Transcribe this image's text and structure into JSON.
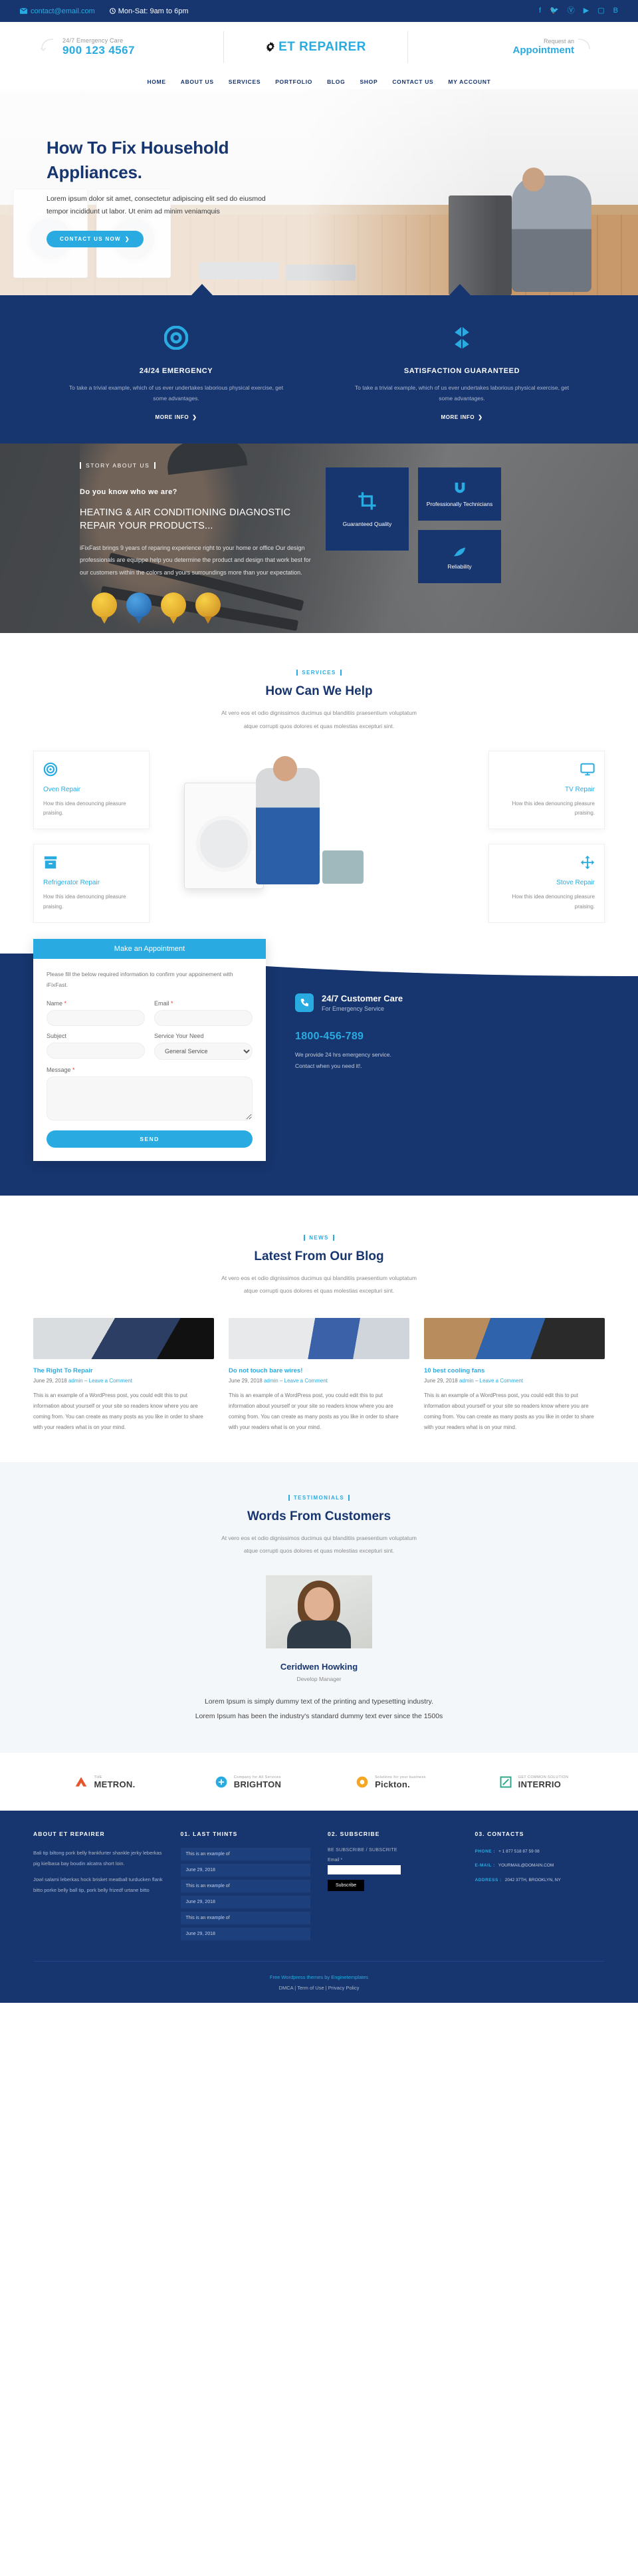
{
  "topbar": {
    "email": "contact@email.com",
    "hours": "Mon-Sat: 9am to 6pm",
    "social": [
      "facebook-icon",
      "twitter-icon",
      "pinterest-icon",
      "youtube-icon",
      "instagram-icon",
      "behance-icon"
    ]
  },
  "header": {
    "emergency_label": "24/7 Emergency Care",
    "phone": "900 123 4567",
    "logo": "ET REPAIRER",
    "appointment_label": "Request an",
    "appointment_value": "Appointment"
  },
  "nav": {
    "items": [
      "HOME",
      "ABOUT US",
      "SERVICES",
      "PORTFOLIO",
      "BLOG",
      "SHOP",
      "CONTACT US",
      "MY ACCOUNT"
    ]
  },
  "hero": {
    "title_line1": "How To Fix Household",
    "title_line2": "Appliances.",
    "paragraph": "Lorem ipsum dolor sit amet, consectetur adipiscing elit sed do eiusmod tempor incididunt ut labor. Ut enim ad minim veniamquis",
    "cta": "CONTACT US NOW"
  },
  "features": [
    {
      "icon": "lifebuoy-icon",
      "title": "24/24 EMERGENCY",
      "text": "To take a trivial example, which of us ever undertakes laborious physical exercise, get some advantages.",
      "more": "MORE INFO"
    },
    {
      "icon": "layers-icon",
      "title": "SATISFACTION GUARANTEED",
      "text": "To take a trivial example, which of us ever undertakes laborious physical exercise, get some advantages.",
      "more": "MORE INFO"
    }
  ],
  "story": {
    "kicker": "STORY ABOUT US",
    "subtitle": "Do you know who we are?",
    "heading": "HEATING & AIR CONDITIONING DIAGNOSTIC REPAIR YOUR PRODUCTS...",
    "paragraph": "iFixFast brings 9 years of reparing experience right to your home or office Our design professionals are equippe help you determine the product and design that work best for our customers within the colors and yours surroundings more than your expectation.",
    "boxes": [
      {
        "icon": "crop-icon",
        "label": "Guaranteed Quality"
      },
      {
        "icon": "magnet-icon",
        "label": "Professionally Technicians"
      },
      {
        "icon": "leaf-icon",
        "label": "Reliability"
      }
    ]
  },
  "services": {
    "kicker": "SERVICES",
    "title": "How Can We Help",
    "sub_line1": "At vero eos et odio dignissimos ducimus qui blanditiis praesentium voluptatum",
    "sub_line2": "atque corrupti quos dolores et quas molestias excepturi sint.",
    "left": [
      {
        "icon": "target-icon",
        "title": "Oven Repair",
        "text": "How this idea denouncing pleasure praising."
      },
      {
        "icon": "box-icon",
        "title": "Refrigerator Repair",
        "text": "How this idea denouncing pleasure praising."
      }
    ],
    "right": [
      {
        "icon": "monitor-icon",
        "title": "TV Repair",
        "text": "How this idea denouncing pleasure praising."
      },
      {
        "icon": "move-icon",
        "title": "Stove Repair",
        "text": "How this idea denouncing pleasure praising."
      }
    ]
  },
  "appointment": {
    "form_title": "Make an Appointment",
    "intro": "Please fill the below required information to confirm your appoinement with iFixFast.",
    "name_label": "Name",
    "email_label": "Email",
    "subject_label": "Subject",
    "service_label": "Service Your Need",
    "service_value": "General Service",
    "service_options": [
      "General Service"
    ],
    "message_label": "Message",
    "name_value": "",
    "email_value": "",
    "subject_value": "",
    "message_value": "",
    "submit": "SEND"
  },
  "care": {
    "title": "24/7 Customer Care",
    "subtitle": "For Emergency Service",
    "icon": "phone-icon",
    "number": "1800-456-789",
    "line1": "We provide 24 hrs emergency service.",
    "line2": "Contact when you need it!."
  },
  "blog": {
    "kicker": "NEWS",
    "title": "Latest From Our Blog",
    "sub_line1": "At vero eos et odio dignissimos ducimus qui blanditiis praesentium voluptatum",
    "sub_line2": "atque corrupti quos dolores et quas molestias excepturi sint.",
    "posts": [
      {
        "title": "The Right To Repair",
        "date": "June 29, 2018",
        "author": "admin",
        "comment": "Leave a Comment",
        "excerpt": "This is an example of a WordPress post, you could edit this to put information about yourself or your site so readers know where you are coming from. You can create as many posts as you like in order to share with your readers what is on your mind."
      },
      {
        "title": "Do not touch bare wires!",
        "date": "June 29, 2018",
        "author": "admin",
        "comment": "Leave a Comment",
        "excerpt": "This is an example of a WordPress post, you could edit this to put information about yourself or your site so readers know where you are coming from. You can create as many posts as you like in order to share with your readers what is on your mind."
      },
      {
        "title": "10 best cooling fans",
        "date": "June 29, 2018",
        "author": "admin",
        "comment": "Leave a Comment",
        "excerpt": "This is an example of a WordPress post, you could edit this to put information about yourself or your site so readers know where you are coming from. You can create as many posts as you like in order to share with your readers what is on your mind."
      }
    ]
  },
  "testimonials": {
    "kicker": "TESTIMONIALS",
    "title": "Words From Customers",
    "sub_line1": "At vero eos et odio dignissimos ducimus qui blanditiis praesentium voluptatum",
    "sub_line2": "atque corrupti quos dolores et quas molestias excepturi sint.",
    "name": "Ceridwen Howking",
    "role": "Develop Manager",
    "quote_line1": "Lorem Ipsum is simply dummy text of the printing and typesetting industry.",
    "quote_line2": "Lorem Ipsum has been the industry's standard dummy text ever since the 1500s"
  },
  "brands": [
    {
      "name": "METRON.",
      "sub": "THE",
      "mark": "metron-mark-icon"
    },
    {
      "name": "BRIGHTON",
      "sub": "Company for All Services",
      "mark": "brighton-mark-icon"
    },
    {
      "name": "Pickton.",
      "sub": "Solutions for your business",
      "mark": "pickton-mark-icon"
    },
    {
      "name": "INTERRIO",
      "sub": "GET COMMON SOLUTION",
      "mark": "interrio-mark-icon"
    }
  ],
  "footer": {
    "col1": {
      "title": "ABOUT ET REPAIRER",
      "p1": "Bali tip biltong pork belly frankfurter shankle jerky leberkas pig kielbasa bay boudin alcatra short loin.",
      "p2": "Jowl salami leberkas hock brisket meatball turducken flank bitto porke belly ball tip, pork belly frizedf urtane bitto"
    },
    "col2": {
      "title": "01. LAST THINTS",
      "items": [
        "This is an example of",
        "June 29, 2018",
        "This is an example of",
        "June 29, 2018",
        "This is an example of",
        "June 29, 2018"
      ]
    },
    "col3": {
      "title": "02. SUBSCRIBE",
      "label": "BE SUBSCRIBE / SUBSCRITE",
      "email_label": "Email *",
      "email_value": "",
      "button": "Subscribe"
    },
    "col4": {
      "title": "03. CONTACTS",
      "rows": [
        {
          "label": "PHONE :",
          "value": "+ 1 877 518 87 59 08"
        },
        {
          "label": "E-MAIL :",
          "value": "YOURMAIL@DOMAIN.COM"
        },
        {
          "label": "ADDRESS :",
          "value": "2042 37TH, BROOKLYN, NY"
        }
      ]
    },
    "bottom_line1": "Free Wordpress themes by Enginetemplates",
    "bottom_links": [
      "DMCA",
      "Term of Use",
      "Privacy Policy"
    ]
  }
}
